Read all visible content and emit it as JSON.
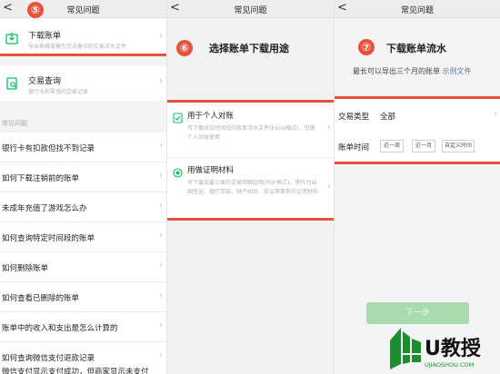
{
  "topbar": {
    "back_glyph": "<",
    "title": "常见问题"
  },
  "panel1": {
    "step": "⑤",
    "cards": [
      {
        "title": "下载账单",
        "subtitle": "导出表格或留在您设备中的交易流水文件",
        "icon": "download-icon"
      },
      {
        "title": "交易查询",
        "subtitle": "银行卡和零钱的交易记录",
        "icon": "receipt-search-icon"
      }
    ],
    "section_label": "常见问题",
    "faq": [
      "银行卡有扣款但找不到记录",
      "如何下载注销前的账单",
      "未成年充值了游戏怎么办",
      "如何查询特定时间段的账单",
      "如何删除账单",
      "如何查看已删除的账单",
      "账单中的收入和支出是怎么计算的",
      "如何查询微信支付退款记录",
      "微信支付显示支付成功，但商家显示未支付"
    ]
  },
  "panel2": {
    "step": "⑥",
    "heading": "选择账单下载用途",
    "options": [
      {
        "title": "用于个人对账",
        "desc": "可下载对应时间段的账单流水文件(Excel格式)，仅做个人对账使用",
        "icon": "document-check-icon"
      },
      {
        "title": "用做证明材料",
        "desc": "可下载加盖公章的交易明细证明(PDF格式)，常作为出国签证、银行贷款、财产纠纷、诉讼等事务的证明材料",
        "icon": "radio-selected-icon"
      }
    ]
  },
  "panel3": {
    "step": "⑦",
    "heading": "下载账单流水",
    "note": "最长可以导出三个月的账单",
    "note_link": "示例文件",
    "type_label": "交易类型",
    "type_value": "全部",
    "time_label": "账单时间",
    "chips": [
      "近一周",
      "近一月",
      "自定义时间"
    ],
    "next_button": "下一步"
  },
  "watermark": {
    "brand": "U教授",
    "domain": "UJIAOSHOU.COM"
  },
  "colors": {
    "accent_red": "#e8513a",
    "wechat_green": "#07c160",
    "link_blue": "#5b7fa6"
  }
}
